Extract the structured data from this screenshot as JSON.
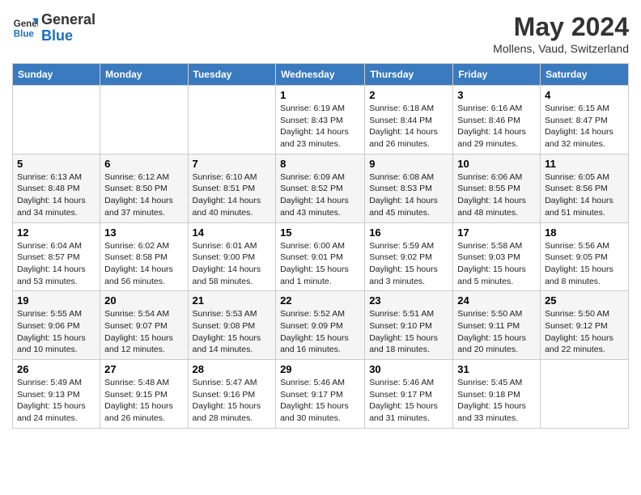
{
  "logo": {
    "line1": "General",
    "line2": "Blue"
  },
  "title": "May 2024",
  "location": "Mollens, Vaud, Switzerland",
  "days_of_week": [
    "Sunday",
    "Monday",
    "Tuesday",
    "Wednesday",
    "Thursday",
    "Friday",
    "Saturday"
  ],
  "weeks": [
    [
      {
        "num": "",
        "sunrise": "",
        "sunset": "",
        "daylight": ""
      },
      {
        "num": "",
        "sunrise": "",
        "sunset": "",
        "daylight": ""
      },
      {
        "num": "",
        "sunrise": "",
        "sunset": "",
        "daylight": ""
      },
      {
        "num": "1",
        "sunrise": "6:19 AM",
        "sunset": "8:43 PM",
        "daylight": "14 hours and 23 minutes."
      },
      {
        "num": "2",
        "sunrise": "6:18 AM",
        "sunset": "8:44 PM",
        "daylight": "14 hours and 26 minutes."
      },
      {
        "num": "3",
        "sunrise": "6:16 AM",
        "sunset": "8:46 PM",
        "daylight": "14 hours and 29 minutes."
      },
      {
        "num": "4",
        "sunrise": "6:15 AM",
        "sunset": "8:47 PM",
        "daylight": "14 hours and 32 minutes."
      }
    ],
    [
      {
        "num": "5",
        "sunrise": "6:13 AM",
        "sunset": "8:48 PM",
        "daylight": "14 hours and 34 minutes."
      },
      {
        "num": "6",
        "sunrise": "6:12 AM",
        "sunset": "8:50 PM",
        "daylight": "14 hours and 37 minutes."
      },
      {
        "num": "7",
        "sunrise": "6:10 AM",
        "sunset": "8:51 PM",
        "daylight": "14 hours and 40 minutes."
      },
      {
        "num": "8",
        "sunrise": "6:09 AM",
        "sunset": "8:52 PM",
        "daylight": "14 hours and 43 minutes."
      },
      {
        "num": "9",
        "sunrise": "6:08 AM",
        "sunset": "8:53 PM",
        "daylight": "14 hours and 45 minutes."
      },
      {
        "num": "10",
        "sunrise": "6:06 AM",
        "sunset": "8:55 PM",
        "daylight": "14 hours and 48 minutes."
      },
      {
        "num": "11",
        "sunrise": "6:05 AM",
        "sunset": "8:56 PM",
        "daylight": "14 hours and 51 minutes."
      }
    ],
    [
      {
        "num": "12",
        "sunrise": "6:04 AM",
        "sunset": "8:57 PM",
        "daylight": "14 hours and 53 minutes."
      },
      {
        "num": "13",
        "sunrise": "6:02 AM",
        "sunset": "8:58 PM",
        "daylight": "14 hours and 56 minutes."
      },
      {
        "num": "14",
        "sunrise": "6:01 AM",
        "sunset": "9:00 PM",
        "daylight": "14 hours and 58 minutes."
      },
      {
        "num": "15",
        "sunrise": "6:00 AM",
        "sunset": "9:01 PM",
        "daylight": "15 hours and 1 minute."
      },
      {
        "num": "16",
        "sunrise": "5:59 AM",
        "sunset": "9:02 PM",
        "daylight": "15 hours and 3 minutes."
      },
      {
        "num": "17",
        "sunrise": "5:58 AM",
        "sunset": "9:03 PM",
        "daylight": "15 hours and 5 minutes."
      },
      {
        "num": "18",
        "sunrise": "5:56 AM",
        "sunset": "9:05 PM",
        "daylight": "15 hours and 8 minutes."
      }
    ],
    [
      {
        "num": "19",
        "sunrise": "5:55 AM",
        "sunset": "9:06 PM",
        "daylight": "15 hours and 10 minutes."
      },
      {
        "num": "20",
        "sunrise": "5:54 AM",
        "sunset": "9:07 PM",
        "daylight": "15 hours and 12 minutes."
      },
      {
        "num": "21",
        "sunrise": "5:53 AM",
        "sunset": "9:08 PM",
        "daylight": "15 hours and 14 minutes."
      },
      {
        "num": "22",
        "sunrise": "5:52 AM",
        "sunset": "9:09 PM",
        "daylight": "15 hours and 16 minutes."
      },
      {
        "num": "23",
        "sunrise": "5:51 AM",
        "sunset": "9:10 PM",
        "daylight": "15 hours and 18 minutes."
      },
      {
        "num": "24",
        "sunrise": "5:50 AM",
        "sunset": "9:11 PM",
        "daylight": "15 hours and 20 minutes."
      },
      {
        "num": "25",
        "sunrise": "5:50 AM",
        "sunset": "9:12 PM",
        "daylight": "15 hours and 22 minutes."
      }
    ],
    [
      {
        "num": "26",
        "sunrise": "5:49 AM",
        "sunset": "9:13 PM",
        "daylight": "15 hours and 24 minutes."
      },
      {
        "num": "27",
        "sunrise": "5:48 AM",
        "sunset": "9:15 PM",
        "daylight": "15 hours and 26 minutes."
      },
      {
        "num": "28",
        "sunrise": "5:47 AM",
        "sunset": "9:16 PM",
        "daylight": "15 hours and 28 minutes."
      },
      {
        "num": "29",
        "sunrise": "5:46 AM",
        "sunset": "9:17 PM",
        "daylight": "15 hours and 30 minutes."
      },
      {
        "num": "30",
        "sunrise": "5:46 AM",
        "sunset": "9:17 PM",
        "daylight": "15 hours and 31 minutes."
      },
      {
        "num": "31",
        "sunrise": "5:45 AM",
        "sunset": "9:18 PM",
        "daylight": "15 hours and 33 minutes."
      },
      {
        "num": "",
        "sunrise": "",
        "sunset": "",
        "daylight": ""
      }
    ]
  ]
}
